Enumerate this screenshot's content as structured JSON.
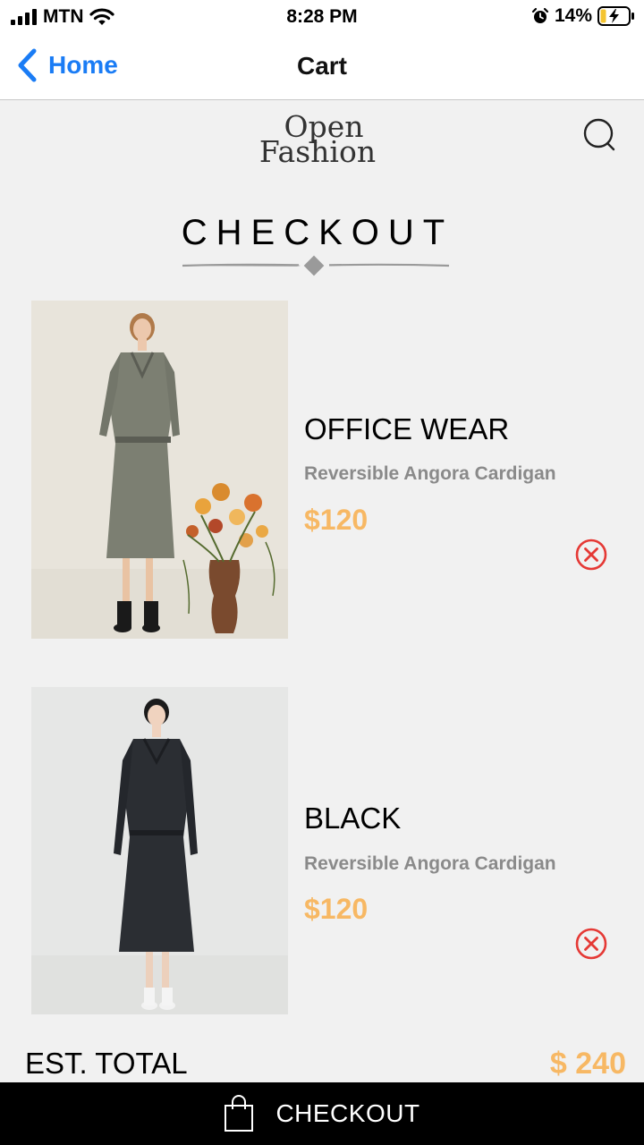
{
  "status": {
    "carrier": "MTN",
    "time": "8:28 PM",
    "battery": "14%"
  },
  "nav": {
    "back_label": "Home",
    "title": "Cart"
  },
  "brand": {
    "line1": "Open",
    "line2": "Fashion"
  },
  "page": {
    "heading": "CHECKOUT"
  },
  "items": [
    {
      "title": "OFFICE WEAR",
      "subtitle": "Reversible Angora Cardigan",
      "price": "$120"
    },
    {
      "title": "BLACK",
      "subtitle": "Reversible Angora Cardigan",
      "price": "$120"
    }
  ],
  "total": {
    "label": "EST. TOTAL",
    "value": "$ 240"
  },
  "checkout_bar": {
    "label": "CHECKOUT"
  },
  "colors": {
    "accent": "#f7b864",
    "link": "#1a7cf5",
    "remove": "#e53935",
    "bar": "#000000"
  }
}
